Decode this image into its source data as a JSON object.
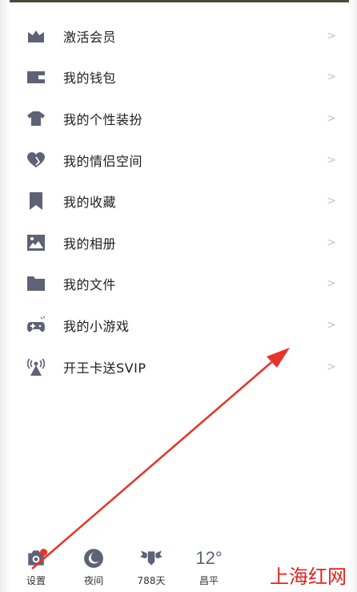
{
  "menu": {
    "items": [
      {
        "label": "激活会员",
        "icon": "crown-icon"
      },
      {
        "label": "我的钱包",
        "icon": "wallet-icon"
      },
      {
        "label": "我的个性装扮",
        "icon": "shirt-icon"
      },
      {
        "label": "我的情侣空间",
        "icon": "heart-icon"
      },
      {
        "label": "我的收藏",
        "icon": "bookmark-icon"
      },
      {
        "label": "我的相册",
        "icon": "photo-icon"
      },
      {
        "label": "我的文件",
        "icon": "folder-icon"
      },
      {
        "label": "我的小游戏",
        "icon": "gamepad-icon"
      },
      {
        "label": "开王卡送SVIP",
        "icon": "broadcast-icon"
      }
    ],
    "chevron": ">"
  },
  "bottom_bar": {
    "settings_label": "设置",
    "night_label": "夜间",
    "days_label": "788天",
    "weather_temp": "12°",
    "weather_city": "昌平"
  },
  "watermark": "上海红网",
  "colors": {
    "icon": "#5d6277",
    "annotation_arrow": "#e8332a",
    "watermark": "#e2231a"
  }
}
